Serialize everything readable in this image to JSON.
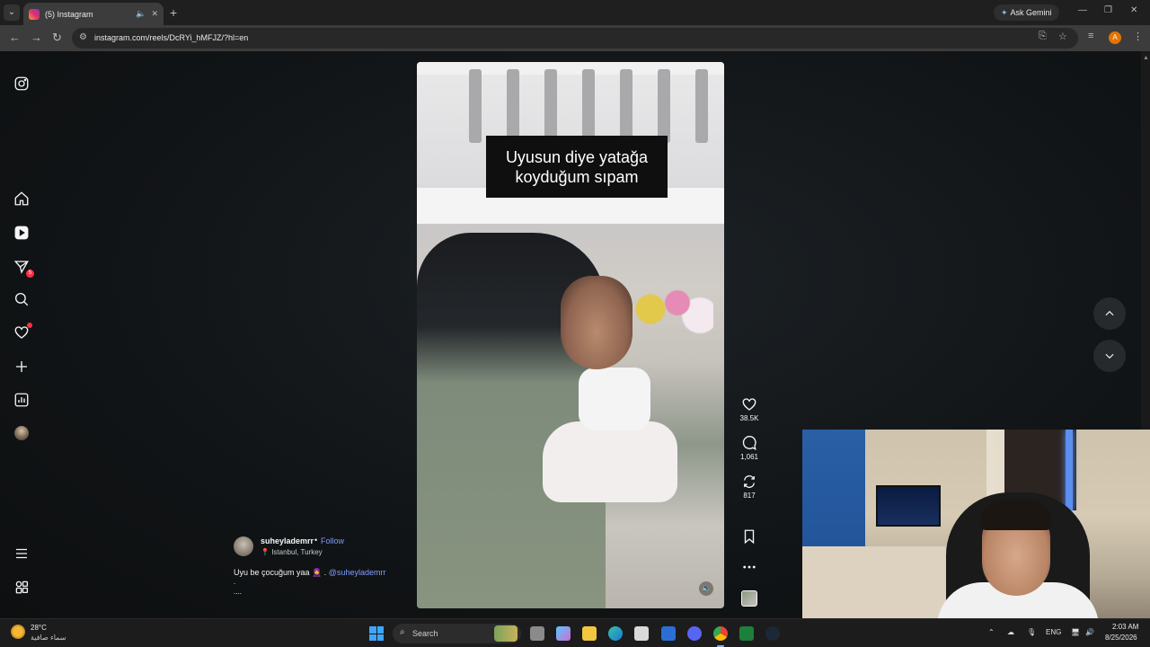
{
  "browser": {
    "tab_title": "(5) Instagram",
    "new_tab": "+",
    "ask_gemini": "Ask Gemini",
    "url": "instagram.com/reels/DcRYi_hMFJZ/?hl=en",
    "profile_initial": "A",
    "controls": {
      "minimize": "—",
      "maximize": "❐",
      "close": "✕"
    }
  },
  "sidebar": {
    "items": [
      {
        "name": "instagram-logo-icon"
      },
      {
        "name": "home-icon"
      },
      {
        "name": "reels-icon"
      },
      {
        "name": "messages-icon",
        "badge": "5"
      },
      {
        "name": "search-icon"
      },
      {
        "name": "notifications-icon"
      },
      {
        "name": "create-icon"
      },
      {
        "name": "dashboard-icon"
      },
      {
        "name": "profile-icon"
      },
      {
        "name": "more-menu-icon"
      },
      {
        "name": "also-from-meta-icon"
      }
    ]
  },
  "reel": {
    "caption_line1": "Uyusun diye yatağa",
    "caption_line2": "koyduğum sıpam",
    "author": "suheylademrr",
    "separator": "•",
    "follow": "Follow",
    "location": "Istanbul, Turkey",
    "post_caption": "Uyu be çocuğum yaa",
    "post_caption_emoji": "🧕 .",
    "mention": "@suheylademrr",
    "caption_dot": ".",
    "caption_more": "...."
  },
  "actions": {
    "likes": "38.5K",
    "comments": "1,061",
    "shares": "817"
  },
  "taskbar": {
    "temperature": "28°C",
    "weather_desc": "سماء صافية",
    "search_placeholder": "Search",
    "language": "ENG",
    "time": "2:03 AM",
    "date": "8/25/2026"
  }
}
